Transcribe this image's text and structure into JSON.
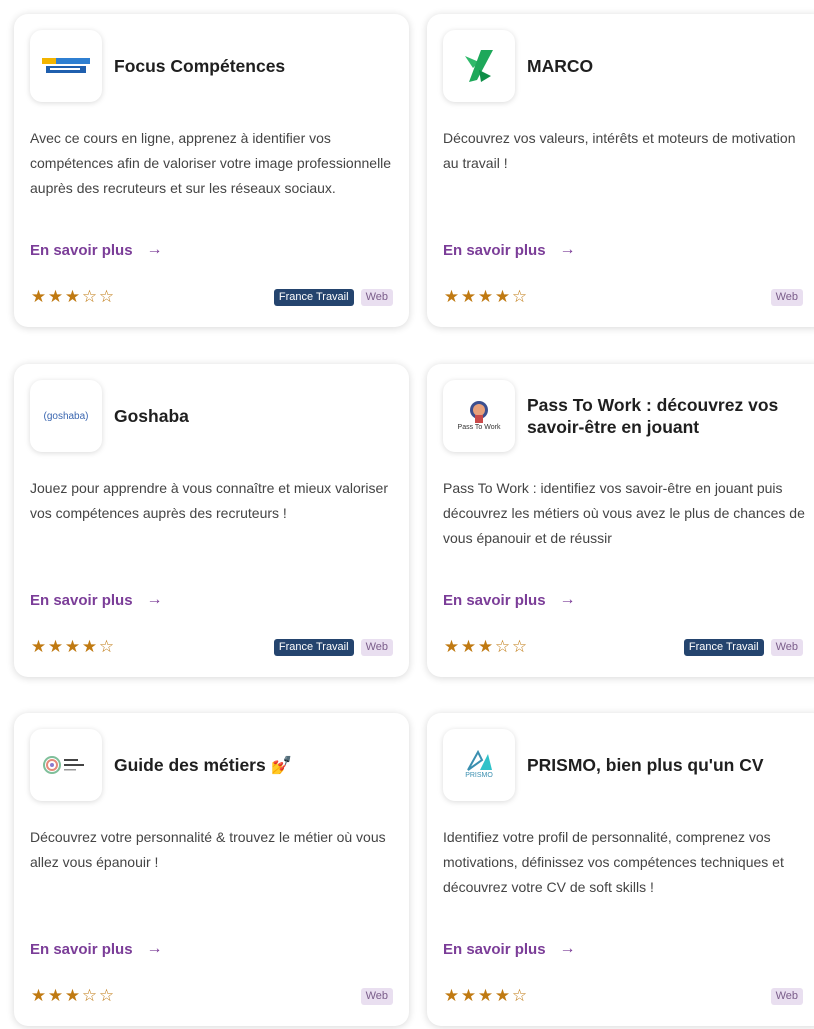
{
  "common": {
    "more_label": "En savoir plus",
    "arrow": "→"
  },
  "cards": [
    {
      "title": "Focus Compétences",
      "description": "Avec ce cours en ligne, apprenez à identifier vos compétences afin de valoriser votre image professionnelle auprès des recruteurs et sur les réseaux sociaux.",
      "rating": 3,
      "rating_max": 5,
      "badges": [
        "France Travail",
        "Web"
      ],
      "logo_icon": "focus-competences-logo"
    },
    {
      "title": "MARCO",
      "description": "Découvrez vos valeurs, intérêts et moteurs de motivation au travail !",
      "rating": 4,
      "rating_max": 5,
      "badges": [
        "Web"
      ],
      "logo_icon": "marco-logo"
    },
    {
      "title": "Goshaba",
      "description": "Jouez pour apprendre à vous connaître et mieux valoriser vos compétences auprès des recruteurs !",
      "rating": 4,
      "rating_max": 5,
      "badges": [
        "France Travail",
        "Web"
      ],
      "logo_icon": "goshaba-logo",
      "logo_text": "(goshaba)"
    },
    {
      "title": "Pass To Work : découvrez vos savoir-être en jouant",
      "description": "Pass To Work : identifiez vos savoir-être en jouant puis découvrez les métiers où vous avez le plus de chances de vous épanouir et de réussir",
      "rating": 3,
      "rating_max": 5,
      "badges": [
        "France Travail",
        "Web"
      ],
      "logo_icon": "pass-to-work-logo",
      "logo_text": "Pass To Work"
    },
    {
      "title": "Guide des métiers 💅",
      "description": "Découvrez votre personnalité & trouvez le métier où vous allez vous épanouir !",
      "rating": 3,
      "rating_max": 5,
      "badges": [
        "Web"
      ],
      "logo_icon": "guide-des-metiers-logo"
    },
    {
      "title": "PRISMO, bien plus qu'un CV",
      "description": "Identifiez votre profil de personnalité, comprenez vos motivations, définissez vos compétences techniques et découvrez votre CV de soft skills !",
      "rating": 4,
      "rating_max": 5,
      "badges": [
        "Web"
      ],
      "logo_icon": "prismo-logo",
      "logo_text": "PRISMO"
    }
  ],
  "colors": {
    "link": "#7b3d98",
    "star": "#c07a12",
    "badge_france_travail": "#24446e",
    "badge_web": "#e9dff0"
  }
}
